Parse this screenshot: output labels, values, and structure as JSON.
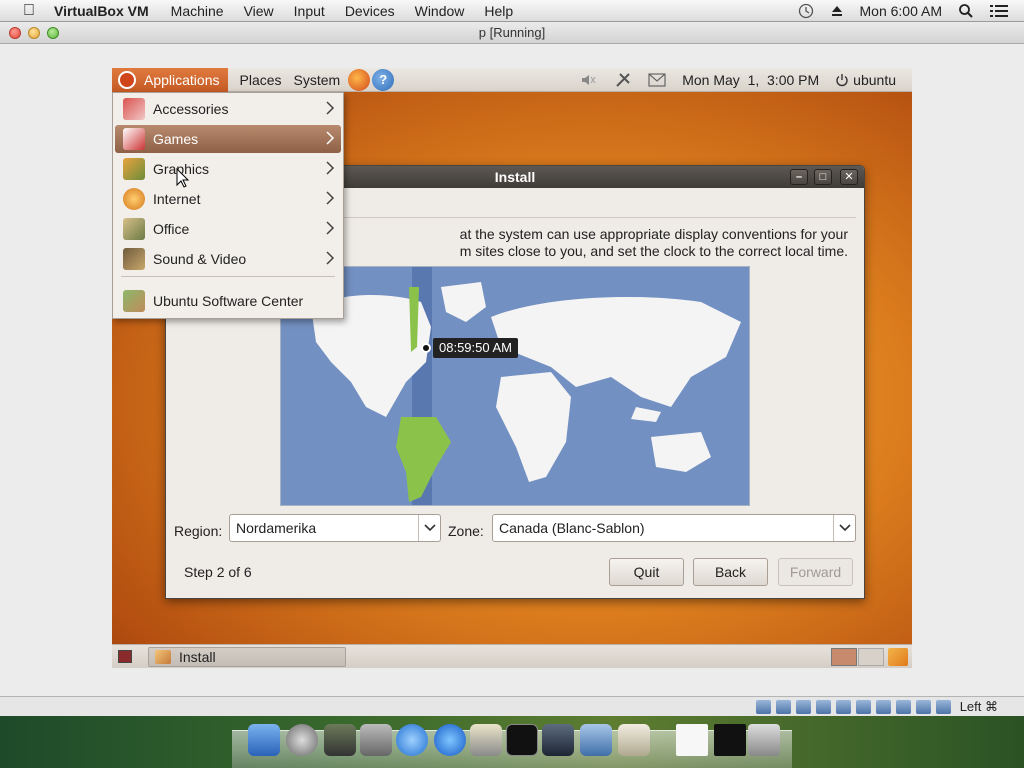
{
  "mac_menubar": {
    "app_name": "VirtualBox VM",
    "menus": [
      "Machine",
      "View",
      "Input",
      "Devices",
      "Window",
      "Help"
    ],
    "clock": "Mon 6:00 AM"
  },
  "window": {
    "title": "p [Running]"
  },
  "gnome_panel": {
    "applications": "Applications",
    "places": "Places",
    "system": "System",
    "datetime": "Mon May  1,  3:00 PM",
    "user": "ubuntu"
  },
  "apps_menu": {
    "items": [
      {
        "label": "Accessories",
        "icon": "accessories-icon"
      },
      {
        "label": "Games",
        "icon": "games-icon"
      },
      {
        "label": "Graphics",
        "icon": "graphics-icon"
      },
      {
        "label": "Internet",
        "icon": "internet-icon"
      },
      {
        "label": "Office",
        "icon": "office-icon"
      },
      {
        "label": "Sound & Video",
        "icon": "sound-video-icon"
      }
    ],
    "software_center": "Ubuntu Software Center"
  },
  "install": {
    "title": "Install",
    "desc_line1": "at the system can use appropriate display conventions for your",
    "desc_line2": "m sites close to you, and set the clock to the correct local time.",
    "time_tooltip": "08:59:50 AM",
    "region_label": "Region:",
    "region_value": "Nordamerika",
    "zone_label": "Zone:",
    "zone_value": "Canada (Blanc-Sablon)",
    "step": "Step 2 of 6",
    "quit": "Quit",
    "back": "Back",
    "forward": "Forward"
  },
  "taskbar": {
    "install": "Install"
  },
  "vm_status": {
    "host_key": "Left ⌘"
  }
}
